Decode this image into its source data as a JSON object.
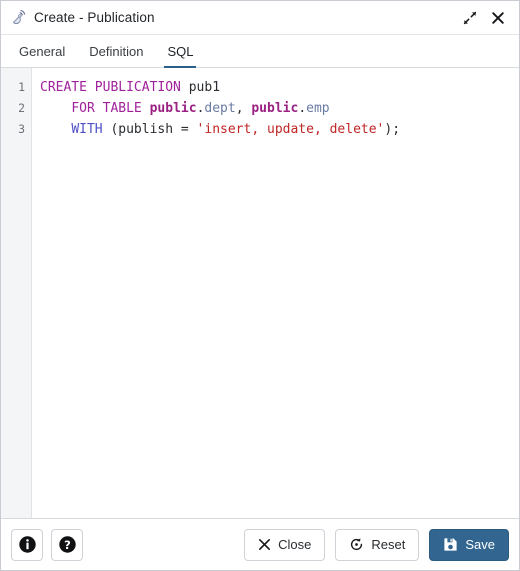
{
  "window": {
    "title": "Create - Publication",
    "icon": "satellite-dish-icon",
    "expand_label": "Expand",
    "close_label": "Close window"
  },
  "tabs": [
    {
      "label": "General",
      "active": false
    },
    {
      "label": "Definition",
      "active": false
    },
    {
      "label": "SQL",
      "active": true
    }
  ],
  "editor": {
    "line_numbers": [
      "1",
      "2",
      "3"
    ],
    "lines": [
      {
        "number": "1",
        "tokens": [
          {
            "text": "CREATE PUBLICATION ",
            "type": "kw"
          },
          {
            "text": "pub1",
            "type": "plain"
          }
        ]
      },
      {
        "number": "2",
        "tokens": [
          {
            "text": "    ",
            "type": "plain"
          },
          {
            "text": "FOR TABLE ",
            "type": "kw"
          },
          {
            "text": "public",
            "type": "schema"
          },
          {
            "text": ".",
            "type": "plain"
          },
          {
            "text": "dept",
            "type": "ident"
          },
          {
            "text": ", ",
            "type": "plain"
          },
          {
            "text": "public",
            "type": "schema"
          },
          {
            "text": ".",
            "type": "plain"
          },
          {
            "text": "emp",
            "type": "ident"
          }
        ]
      },
      {
        "number": "3",
        "tokens": [
          {
            "text": "    ",
            "type": "plain"
          },
          {
            "text": "WITH",
            "type": "kw2"
          },
          {
            "text": " (publish = ",
            "type": "plain"
          },
          {
            "text": "'insert, update, delete'",
            "type": "str"
          },
          {
            "text": ");",
            "type": "plain"
          }
        ]
      }
    ],
    "plain_sql": "CREATE PUBLICATION pub1\n    FOR TABLE public.dept, public.emp\n    WITH (publish = 'insert, update, delete');"
  },
  "footer": {
    "info_label": "Information",
    "help_label": "Help",
    "close_label": "Close",
    "reset_label": "Reset",
    "save_label": "Save"
  },
  "colors": {
    "accent": "#326690",
    "tab_underline": "#2c5f88",
    "keyword": "#a0219c",
    "keyword_alt": "#5050c8",
    "schema": "#9b2283",
    "identifier": "#6a7ba3",
    "string": "#bf2626",
    "gutter_bg": "#f4f5f7",
    "border": "#d7dade"
  }
}
